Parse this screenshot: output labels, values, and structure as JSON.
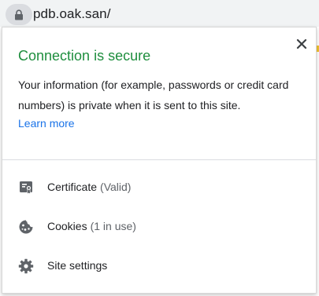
{
  "address_bar": {
    "url": "pdb.oak.san/",
    "lock_icon": "lock-icon"
  },
  "popup": {
    "title": "Connection is secure",
    "description": "Your information (for example, passwords or credit card numbers) is private when it is sent to this site.",
    "learn_more": "Learn more",
    "close_icon": "close-icon",
    "items": [
      {
        "label": "Certificate",
        "detail": "(Valid)",
        "icon": "certificate-icon"
      },
      {
        "label": "Cookies",
        "detail": "(1 in use)",
        "icon": "cookie-icon"
      },
      {
        "label": "Site settings",
        "detail": "",
        "icon": "gear-icon"
      }
    ]
  },
  "colors": {
    "title_green": "#1e8e3e",
    "link_blue": "#1a73e8",
    "text": "#202124",
    "muted": "#5f6368"
  }
}
